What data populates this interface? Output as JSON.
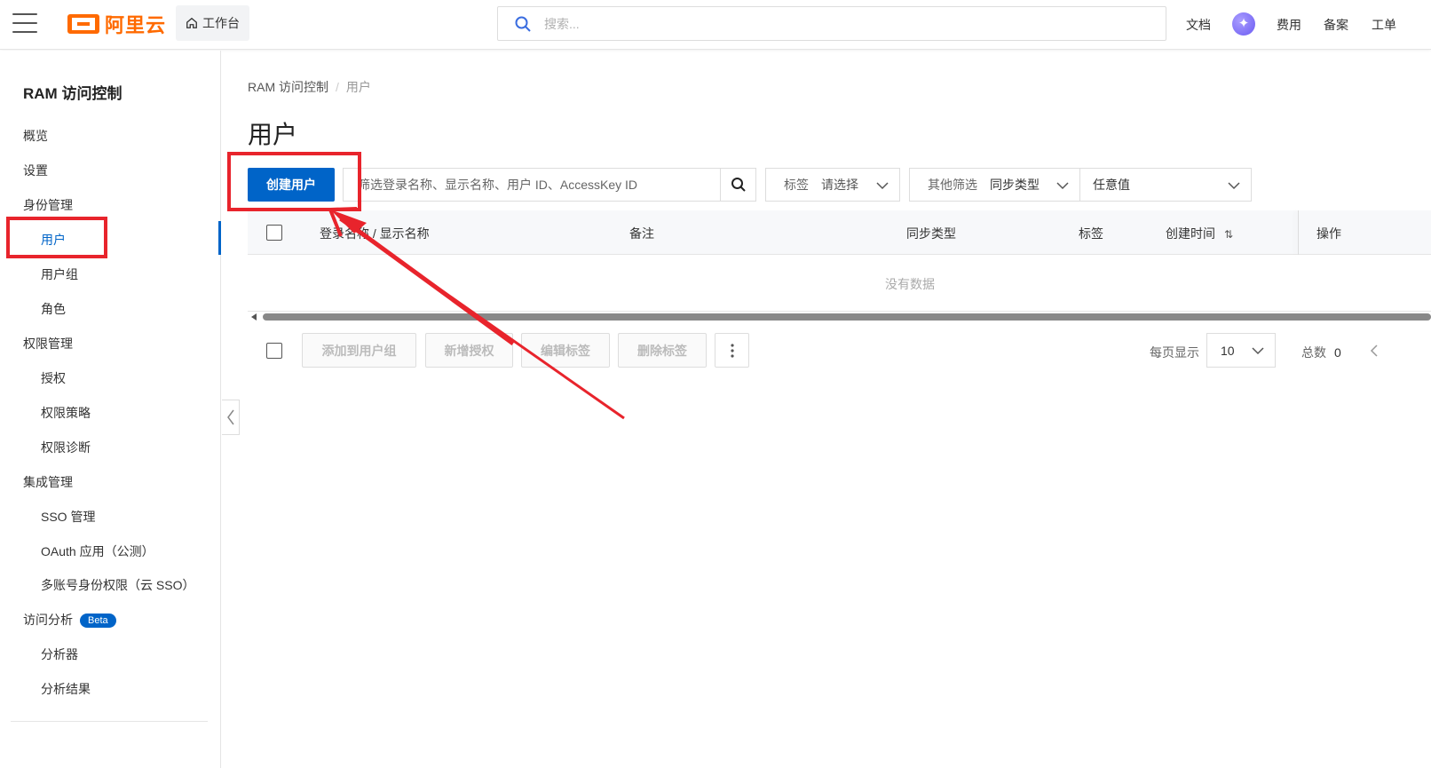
{
  "topbar": {
    "brand": "阿里云",
    "workbench_label": "工作台",
    "search_placeholder": "搜索...",
    "links": [
      "文档",
      "费用",
      "备案",
      "工单"
    ]
  },
  "sidebar": {
    "title": "RAM 访问控制",
    "items": [
      {
        "label": "概览",
        "level": 1
      },
      {
        "label": "设置",
        "level": 1
      },
      {
        "label": "身份管理",
        "level": 1
      },
      {
        "label": "用户",
        "level": 2,
        "active": true
      },
      {
        "label": "用户组",
        "level": 2
      },
      {
        "label": "角色",
        "level": 2
      },
      {
        "label": "权限管理",
        "level": 1
      },
      {
        "label": "授权",
        "level": 2
      },
      {
        "label": "权限策略",
        "level": 2
      },
      {
        "label": "权限诊断",
        "level": 2
      },
      {
        "label": "集成管理",
        "level": 1
      },
      {
        "label": "SSO 管理",
        "level": 2
      },
      {
        "label": "OAuth 应用（公测）",
        "level": 2
      },
      {
        "label": "多账号身份权限（云 SSO）",
        "level": 2
      },
      {
        "label": "访问分析",
        "level": 1,
        "badge": "Beta"
      },
      {
        "label": "分析器",
        "level": 2
      },
      {
        "label": "分析结果",
        "level": 2
      }
    ]
  },
  "breadcrumb": [
    "RAM 访问控制",
    "用户"
  ],
  "page_title": "用户",
  "toolbar": {
    "create_button": "创建用户",
    "filter_placeholder": "筛选登录名称、显示名称、用户 ID、AccessKey ID",
    "tag_filter_label": "标签",
    "tag_filter_value": "请选择",
    "other_filter_label": "其他筛选",
    "other_filter_value": "同步类型",
    "any_value": "任意值"
  },
  "table": {
    "columns": [
      "登录名称 / 显示名称",
      "备注",
      "同步类型",
      "标签",
      "创建时间",
      "操作"
    ],
    "sort_indicator": "⇅",
    "empty_text": "没有数据"
  },
  "batch_actions": [
    "添加到用户组",
    "新增授权",
    "编辑标签",
    "删除标签"
  ],
  "pagination": {
    "page_size_label": "每页显示",
    "page_size": "10",
    "total_label": "总数",
    "total": "0"
  },
  "colors": {
    "primary": "#0064c8",
    "brand": "#ff6a00",
    "annotation": "#e8242c"
  }
}
